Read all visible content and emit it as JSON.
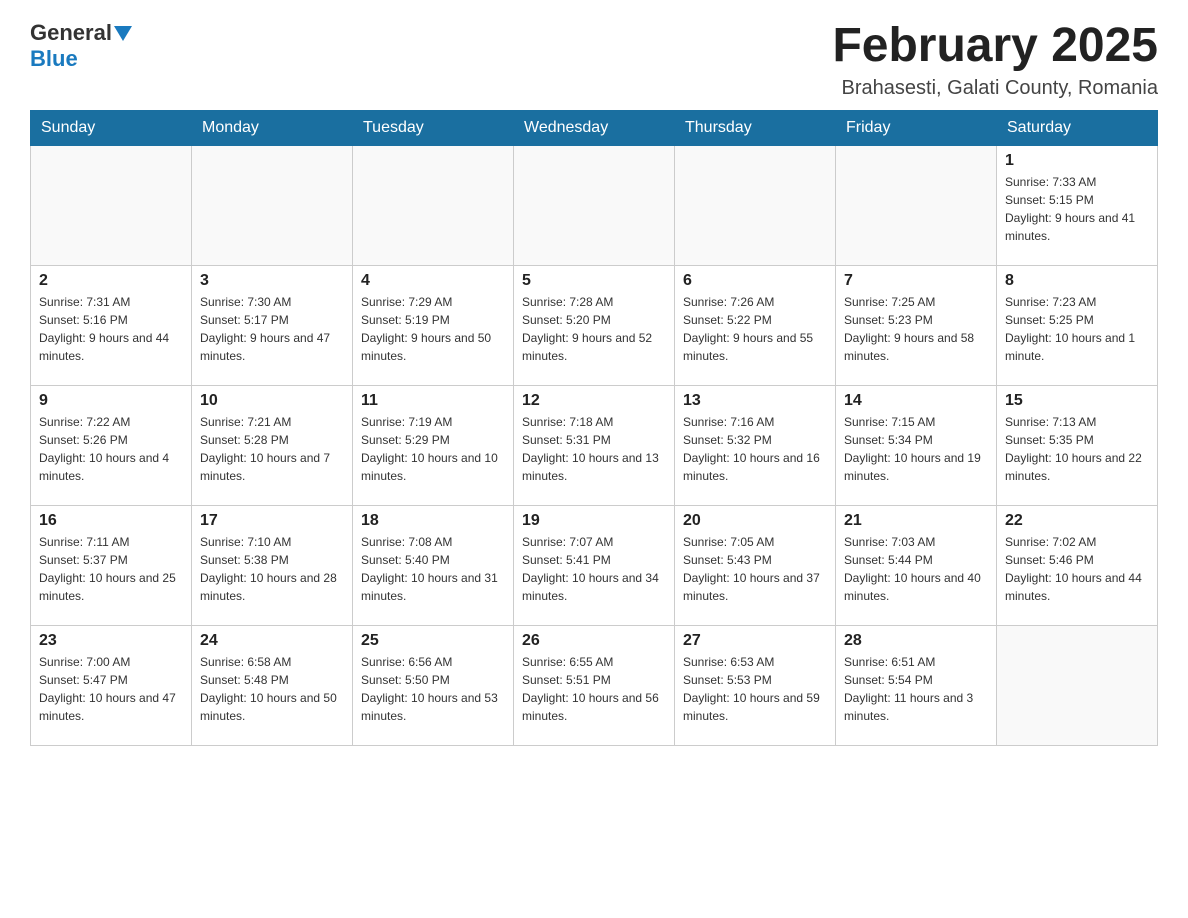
{
  "header": {
    "logo_general": "General",
    "logo_blue": "Blue",
    "month_title": "February 2025",
    "location": "Brahasesti, Galati County, Romania"
  },
  "weekdays": [
    "Sunday",
    "Monday",
    "Tuesday",
    "Wednesday",
    "Thursday",
    "Friday",
    "Saturday"
  ],
  "weeks": [
    [
      {
        "day": "",
        "info": ""
      },
      {
        "day": "",
        "info": ""
      },
      {
        "day": "",
        "info": ""
      },
      {
        "day": "",
        "info": ""
      },
      {
        "day": "",
        "info": ""
      },
      {
        "day": "",
        "info": ""
      },
      {
        "day": "1",
        "info": "Sunrise: 7:33 AM\nSunset: 5:15 PM\nDaylight: 9 hours and 41 minutes."
      }
    ],
    [
      {
        "day": "2",
        "info": "Sunrise: 7:31 AM\nSunset: 5:16 PM\nDaylight: 9 hours and 44 minutes."
      },
      {
        "day": "3",
        "info": "Sunrise: 7:30 AM\nSunset: 5:17 PM\nDaylight: 9 hours and 47 minutes."
      },
      {
        "day": "4",
        "info": "Sunrise: 7:29 AM\nSunset: 5:19 PM\nDaylight: 9 hours and 50 minutes."
      },
      {
        "day": "5",
        "info": "Sunrise: 7:28 AM\nSunset: 5:20 PM\nDaylight: 9 hours and 52 minutes."
      },
      {
        "day": "6",
        "info": "Sunrise: 7:26 AM\nSunset: 5:22 PM\nDaylight: 9 hours and 55 minutes."
      },
      {
        "day": "7",
        "info": "Sunrise: 7:25 AM\nSunset: 5:23 PM\nDaylight: 9 hours and 58 minutes."
      },
      {
        "day": "8",
        "info": "Sunrise: 7:23 AM\nSunset: 5:25 PM\nDaylight: 10 hours and 1 minute."
      }
    ],
    [
      {
        "day": "9",
        "info": "Sunrise: 7:22 AM\nSunset: 5:26 PM\nDaylight: 10 hours and 4 minutes."
      },
      {
        "day": "10",
        "info": "Sunrise: 7:21 AM\nSunset: 5:28 PM\nDaylight: 10 hours and 7 minutes."
      },
      {
        "day": "11",
        "info": "Sunrise: 7:19 AM\nSunset: 5:29 PM\nDaylight: 10 hours and 10 minutes."
      },
      {
        "day": "12",
        "info": "Sunrise: 7:18 AM\nSunset: 5:31 PM\nDaylight: 10 hours and 13 minutes."
      },
      {
        "day": "13",
        "info": "Sunrise: 7:16 AM\nSunset: 5:32 PM\nDaylight: 10 hours and 16 minutes."
      },
      {
        "day": "14",
        "info": "Sunrise: 7:15 AM\nSunset: 5:34 PM\nDaylight: 10 hours and 19 minutes."
      },
      {
        "day": "15",
        "info": "Sunrise: 7:13 AM\nSunset: 5:35 PM\nDaylight: 10 hours and 22 minutes."
      }
    ],
    [
      {
        "day": "16",
        "info": "Sunrise: 7:11 AM\nSunset: 5:37 PM\nDaylight: 10 hours and 25 minutes."
      },
      {
        "day": "17",
        "info": "Sunrise: 7:10 AM\nSunset: 5:38 PM\nDaylight: 10 hours and 28 minutes."
      },
      {
        "day": "18",
        "info": "Sunrise: 7:08 AM\nSunset: 5:40 PM\nDaylight: 10 hours and 31 minutes."
      },
      {
        "day": "19",
        "info": "Sunrise: 7:07 AM\nSunset: 5:41 PM\nDaylight: 10 hours and 34 minutes."
      },
      {
        "day": "20",
        "info": "Sunrise: 7:05 AM\nSunset: 5:43 PM\nDaylight: 10 hours and 37 minutes."
      },
      {
        "day": "21",
        "info": "Sunrise: 7:03 AM\nSunset: 5:44 PM\nDaylight: 10 hours and 40 minutes."
      },
      {
        "day": "22",
        "info": "Sunrise: 7:02 AM\nSunset: 5:46 PM\nDaylight: 10 hours and 44 minutes."
      }
    ],
    [
      {
        "day": "23",
        "info": "Sunrise: 7:00 AM\nSunset: 5:47 PM\nDaylight: 10 hours and 47 minutes."
      },
      {
        "day": "24",
        "info": "Sunrise: 6:58 AM\nSunset: 5:48 PM\nDaylight: 10 hours and 50 minutes."
      },
      {
        "day": "25",
        "info": "Sunrise: 6:56 AM\nSunset: 5:50 PM\nDaylight: 10 hours and 53 minutes."
      },
      {
        "day": "26",
        "info": "Sunrise: 6:55 AM\nSunset: 5:51 PM\nDaylight: 10 hours and 56 minutes."
      },
      {
        "day": "27",
        "info": "Sunrise: 6:53 AM\nSunset: 5:53 PM\nDaylight: 10 hours and 59 minutes."
      },
      {
        "day": "28",
        "info": "Sunrise: 6:51 AM\nSunset: 5:54 PM\nDaylight: 11 hours and 3 minutes."
      },
      {
        "day": "",
        "info": ""
      }
    ]
  ]
}
